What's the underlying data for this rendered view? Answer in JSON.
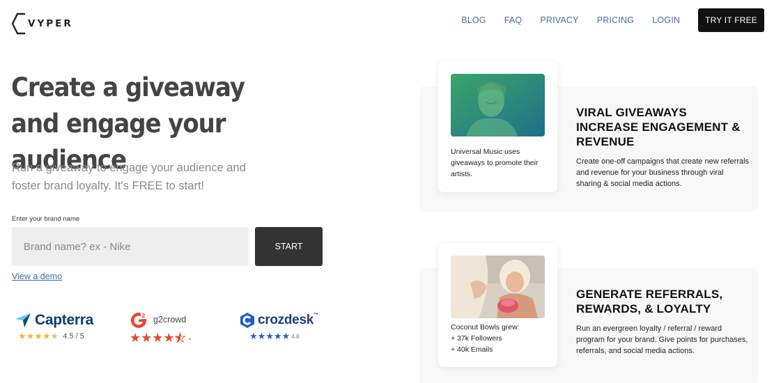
{
  "header": {
    "logo_text": "VYPER",
    "nav": [
      "BLOG",
      "FAQ",
      "PRIVACY",
      "PRICING",
      "LOGIN"
    ],
    "cta": "TRY IT FREE"
  },
  "hero": {
    "title": "Create a giveaway and engage your audience",
    "subtitle": "Run a giveaway to engage your audience and foster brand loyalty. It's FREE to start!",
    "input_label": "Enter your brand name",
    "input_placeholder": "Brand name? ex - Nike",
    "start_label": "START",
    "demo_link": "View a demo"
  },
  "ratings": {
    "capterra": {
      "name": "Capterra",
      "score": "4.5 / 5",
      "stars": 4.5,
      "star_color": "#f7b731"
    },
    "g2": {
      "name": "g2crowd",
      "stars": 4.5,
      "star_color": "#e2492f"
    },
    "crozdesk": {
      "name": "crozdesk",
      "tm": "™",
      "score": "4.8",
      "stars": 5,
      "star_color": "#1f5fc9"
    }
  },
  "features": [
    {
      "caption": "Universal Music uses giveaways to promote their artists.",
      "title": "VIRAL GIVEAWAYS INCREASE ENGAGEMENT & REVENUE",
      "description": "Create one-off campaigns that create new referrals and revenue for your business through viral sharing & social media actions."
    },
    {
      "caption": "Coconut Bowls grew:\n+ 37k Followers\n+ 40k Emails",
      "title": "GENERATE REFERRALS, REWARDS, & LOYALTY",
      "description": "Run an evergreen loyalty / referral / reward program for your brand. Give points for purchases, referrals, and social media actions."
    }
  ],
  "colors": {
    "nav_link": "#3f6fa8",
    "cta_bg": "#111111",
    "hero_text": "#444444",
    "button_bg": "#333333"
  }
}
